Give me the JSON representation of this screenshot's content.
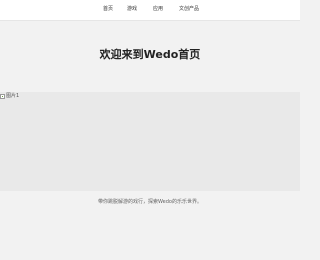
{
  "nav": {
    "items": [
      {
        "label": "首页"
      },
      {
        "label": "游戏"
      },
      {
        "label": "应用"
      },
      {
        "label": "文创产品"
      }
    ]
  },
  "hero": {
    "title": "欢迎来到Wedo首页"
  },
  "banner": {
    "image_alt": "图片1"
  },
  "footer": {
    "tagline": "带你跳脱解游的戏行，探索Wedo的乐乐世界。"
  }
}
